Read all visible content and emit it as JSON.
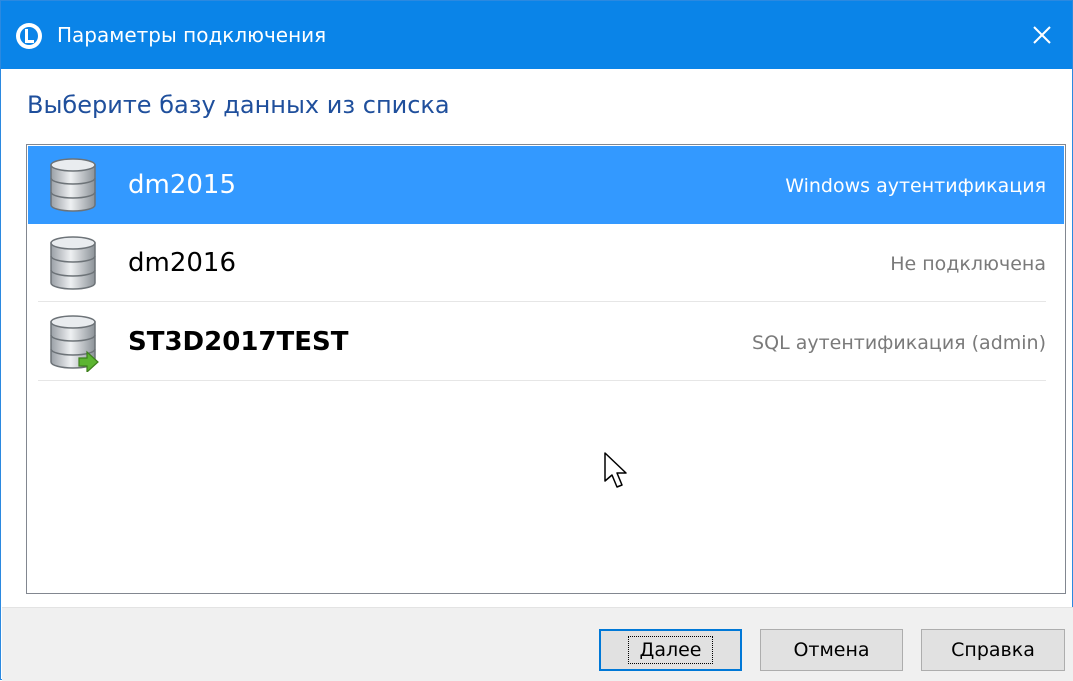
{
  "window": {
    "title": "Параметры подключения",
    "accent_color": "#0a84e8",
    "app_icon": "app-logo-icon",
    "close_icon": "close-icon"
  },
  "heading": "Выберите базу данных из списка",
  "databases": [
    {
      "name": "dm2015",
      "status": "Windows аутентификация",
      "selected": true,
      "bold": false,
      "icon": "database-icon"
    },
    {
      "name": "dm2016",
      "status": "Не подключена",
      "selected": false,
      "bold": false,
      "icon": "database-icon"
    },
    {
      "name": "ST3D2017TEST",
      "status": "SQL аутентификация (admin)",
      "selected": false,
      "bold": true,
      "icon": "database-connected-icon"
    }
  ],
  "selection_color": "#3399ff",
  "buttons": {
    "next": "Далее",
    "cancel": "Отмена",
    "help": "Справка"
  }
}
